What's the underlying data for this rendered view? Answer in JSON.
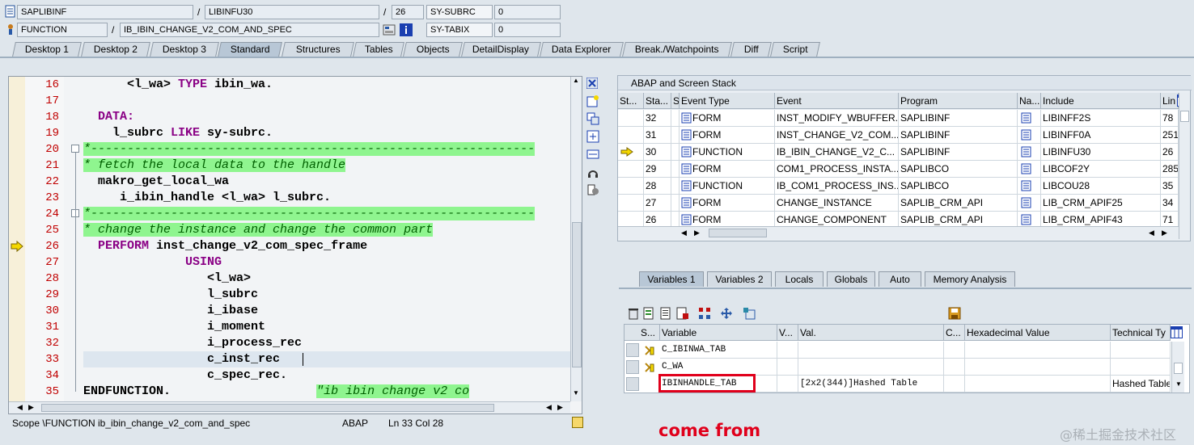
{
  "top": {
    "program": "SAPLIBINF",
    "include": "LIBINFU30",
    "line": "26",
    "sy_subrc_label": "SY-SUBRC",
    "sy_subrc_value": "0",
    "type": "FUNCTION",
    "function": "IB_IBIN_CHANGE_V2_COM_AND_SPEC",
    "sy_tabix_label": "SY-TABIX",
    "sy_tabix_value": "0",
    "slash": "/"
  },
  "tabs": [
    "Desktop 1",
    "Desktop 2",
    "Desktop 3",
    "Standard",
    "Structures",
    "Tables",
    "Objects",
    "DetailDisplay",
    "Data Explorer",
    "Break./Watchpoints",
    "Diff",
    "Script"
  ],
  "editor": {
    "lines": [
      {
        "n": "16",
        "segs": [
          {
            "t": "      <l_wa> ",
            "c": ""
          },
          {
            "t": "TYPE",
            "c": "kw"
          },
          {
            "t": " ibin_wa.",
            "c": ""
          }
        ]
      },
      {
        "n": "17",
        "segs": []
      },
      {
        "n": "18",
        "segs": [
          {
            "t": "  ",
            "c": ""
          },
          {
            "t": "DATA:",
            "c": "kw"
          }
        ]
      },
      {
        "n": "19",
        "segs": [
          {
            "t": "    l_subrc ",
            "c": ""
          },
          {
            "t": "LIKE",
            "c": "kw"
          },
          {
            "t": " sy-subrc.",
            "c": ""
          }
        ]
      },
      {
        "n": "20",
        "segs": [
          {
            "t": "*-------------------------------------------------------------",
            "c": "cm"
          }
        ]
      },
      {
        "n": "21",
        "segs": [
          {
            "t": "* fetch the local data to the handle",
            "c": "cm"
          }
        ]
      },
      {
        "n": "22",
        "segs": [
          {
            "t": "  makro_get_local_wa",
            "c": ""
          }
        ]
      },
      {
        "n": "23",
        "segs": [
          {
            "t": "     i_ibin_handle <l_wa> l_subrc.",
            "c": ""
          }
        ]
      },
      {
        "n": "24",
        "segs": [
          {
            "t": "*-------------------------------------------------------------",
            "c": "cm"
          }
        ]
      },
      {
        "n": "25",
        "segs": [
          {
            "t": "* change the instance and change the common part",
            "c": "cm"
          }
        ]
      },
      {
        "n": "26",
        "segs": [
          {
            "t": "  ",
            "c": ""
          },
          {
            "t": "PERFORM",
            "c": "kw"
          },
          {
            "t": " inst_change_v2_com_spec_frame",
            "c": ""
          }
        ]
      },
      {
        "n": "27",
        "segs": [
          {
            "t": "              ",
            "c": ""
          },
          {
            "t": "USING",
            "c": "kw"
          }
        ]
      },
      {
        "n": "28",
        "segs": [
          {
            "t": "                 <l_wa>",
            "c": ""
          }
        ]
      },
      {
        "n": "29",
        "segs": [
          {
            "t": "                 l_subrc",
            "c": ""
          }
        ]
      },
      {
        "n": "30",
        "segs": [
          {
            "t": "                 i_ibase",
            "c": ""
          }
        ]
      },
      {
        "n": "31",
        "segs": [
          {
            "t": "                 i_moment",
            "c": ""
          }
        ]
      },
      {
        "n": "32",
        "segs": [
          {
            "t": "                 i_process_rec",
            "c": ""
          }
        ]
      },
      {
        "n": "33",
        "segs": [
          {
            "t": "                 c_inst_rec",
            "c": ""
          }
        ]
      },
      {
        "n": "34",
        "segs": [
          {
            "t": "                 c_spec_rec.",
            "c": ""
          }
        ]
      },
      {
        "n": "35",
        "segs": [
          {
            "t": "ENDFUNCTION.",
            "c": ""
          },
          {
            "t": "                    ",
            "c": ""
          },
          {
            "t": "\"ib ibin change v2 co",
            "c": "cm"
          }
        ]
      }
    ],
    "status_scope": "Scope \\FUNCTION ib_ibin_change_v2_com_and_spec",
    "status_lang": "ABAP",
    "status_pos": "Ln  33 Col  28"
  },
  "stack": {
    "title": "ABAP and Screen Stack",
    "headers": [
      "St...",
      "Sta...",
      "S...",
      "Event Type",
      "Event",
      "Program",
      "Na...",
      "Include",
      "Lin"
    ],
    "rows": [
      {
        "level": "32",
        "etype": "FORM",
        "event": "INST_MODIFY_WBUFFER...",
        "program": "SAPLIBINF",
        "include": "LIBINFF2S",
        "line": "78"
      },
      {
        "level": "31",
        "etype": "FORM",
        "event": "INST_CHANGE_V2_COM...",
        "program": "SAPLIBINF",
        "include": "LIBINFF0A",
        "line": "251"
      },
      {
        "level": "30",
        "etype": "FUNCTION",
        "event": "IB_IBIN_CHANGE_V2_C...",
        "program": "SAPLIBINF",
        "include": "LIBINFU30",
        "line": "26"
      },
      {
        "level": "29",
        "etype": "FORM",
        "event": "COM1_PROCESS_INSTA...",
        "program": "SAPLIBCO",
        "include": "LIBCOF2Y",
        "line": "285"
      },
      {
        "level": "28",
        "etype": "FUNCTION",
        "event": "IB_COM1_PROCESS_INS...",
        "program": "SAPLIBCO",
        "include": "LIBCOU28",
        "line": "35"
      },
      {
        "level": "27",
        "etype": "FORM",
        "event": "CHANGE_INSTANCE",
        "program": "SAPLIB_CRM_API",
        "include": "LIB_CRM_APIF25",
        "line": "34"
      },
      {
        "level": "26",
        "etype": "FORM",
        "event": "CHANGE_COMPONENT",
        "program": "SAPLIB_CRM_API",
        "include": "LIB_CRM_APIF43",
        "line": "71"
      }
    ]
  },
  "vartabs": [
    "Variables 1",
    "Variables 2",
    "Locals",
    "Globals",
    "Auto",
    "Memory Analysis"
  ],
  "vars": {
    "headers": [
      "S...",
      "Variable",
      "V...",
      "Val.",
      "C...",
      "Hexadecimal Value",
      "Technical Ty"
    ],
    "rows": [
      {
        "name": "C_IBINWA_TAB",
        "val": "",
        "type": ""
      },
      {
        "name": "C_WA",
        "val": "",
        "type": ""
      },
      {
        "name": "IBINHANDLE_TAB",
        "val": "[2x2(344)]Hashed Table",
        "type": "Hashed Table"
      }
    ]
  },
  "annotation": "come from",
  "watermark": "@稀土掘金技术社区",
  "colors": {
    "annotation": "#e0001b",
    "comment_bg": "#8ff58f",
    "keyword": "#8a0085",
    "line_number": "#c00000"
  }
}
